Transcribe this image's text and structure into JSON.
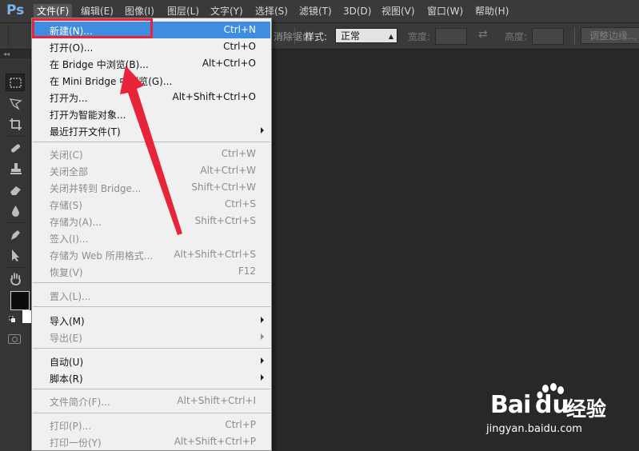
{
  "app": {
    "logo": "Ps"
  },
  "menubar": {
    "items": [
      {
        "label": "文件(F)"
      },
      {
        "label": "编辑(E)"
      },
      {
        "label": "图像(I)"
      },
      {
        "label": "图层(L)"
      },
      {
        "label": "文字(Y)"
      },
      {
        "label": "选择(S)"
      },
      {
        "label": "滤镜(T)"
      },
      {
        "label": "3D(D)"
      },
      {
        "label": "视图(V)"
      },
      {
        "label": "窗口(W)"
      },
      {
        "label": "帮助(H)"
      }
    ],
    "active_index": 0
  },
  "options_bar": {
    "feather_suffix": "消除锯齿",
    "style_label": "样式:",
    "style_value": "正常",
    "width_label": "宽度:",
    "height_label": "高度:",
    "refine_edge_label": "调整边缘..."
  },
  "tools": {
    "header_icon": "collapse-arrows-icon",
    "items": [
      "rect-marquee-icon",
      "lasso-icon",
      "crop-icon",
      "healing-brush-icon",
      "stamp-icon",
      "eraser-icon",
      "blur-drop-icon",
      "pen-icon",
      "path-select-icon",
      "hand-icon"
    ],
    "foreground_color": "#0c0c0c",
    "background_color": "#ffffff"
  },
  "file_menu": {
    "items": [
      {
        "label": "新建(N)...",
        "shortcut": "Ctrl+N",
        "highlighted": true
      },
      {
        "label": "打开(O)...",
        "shortcut": "Ctrl+O"
      },
      {
        "label": "在 Bridge 中浏览(B)...",
        "shortcut": "Alt+Ctrl+O"
      },
      {
        "label": "在 Mini Bridge 中浏览(G)...",
        "shortcut": ""
      },
      {
        "label": "打开为...",
        "shortcut": "Alt+Shift+Ctrl+O"
      },
      {
        "label": "打开为智能对象...",
        "shortcut": ""
      },
      {
        "label": "最近打开文件(T)",
        "shortcut": "",
        "submenu": true
      },
      {
        "label": "关闭(C)",
        "shortcut": "Ctrl+W",
        "disabled": true
      },
      {
        "label": "关闭全部",
        "shortcut": "Alt+Ctrl+W",
        "disabled": true
      },
      {
        "label": "关闭并转到 Bridge...",
        "shortcut": "Shift+Ctrl+W",
        "disabled": true
      },
      {
        "label": "存储(S)",
        "shortcut": "Ctrl+S",
        "disabled": true
      },
      {
        "label": "存储为(A)...",
        "shortcut": "Shift+Ctrl+S",
        "disabled": true
      },
      {
        "label": "签入(I)...",
        "shortcut": "",
        "disabled": true
      },
      {
        "label": "存储为 Web 所用格式...",
        "shortcut": "Alt+Shift+Ctrl+S",
        "disabled": true
      },
      {
        "label": "恢复(V)",
        "shortcut": "F12",
        "disabled": true
      },
      {
        "label": "置入(L)...",
        "shortcut": "",
        "disabled": true
      },
      {
        "label": "导入(M)",
        "shortcut": "",
        "submenu": true
      },
      {
        "label": "导出(E)",
        "shortcut": "",
        "submenu": true,
        "disabled": true
      },
      {
        "label": "自动(U)",
        "shortcut": "",
        "submenu": true
      },
      {
        "label": "脚本(R)",
        "shortcut": "",
        "submenu": true
      },
      {
        "label": "文件简介(F)...",
        "shortcut": "Alt+Shift+Ctrl+I",
        "disabled": true
      },
      {
        "label": "打印(P)...",
        "shortcut": "Ctrl+P",
        "disabled": true
      },
      {
        "label": "打印一份(Y)",
        "shortcut": "Alt+Shift+Ctrl+P",
        "disabled": true
      }
    ]
  },
  "annotations": {
    "accent_color": "#e8243a"
  },
  "watermark": {
    "brand_bai": "Bai",
    "brand_du": "du",
    "brand_jingyan": "经验",
    "url": "jingyan.baidu.com"
  }
}
